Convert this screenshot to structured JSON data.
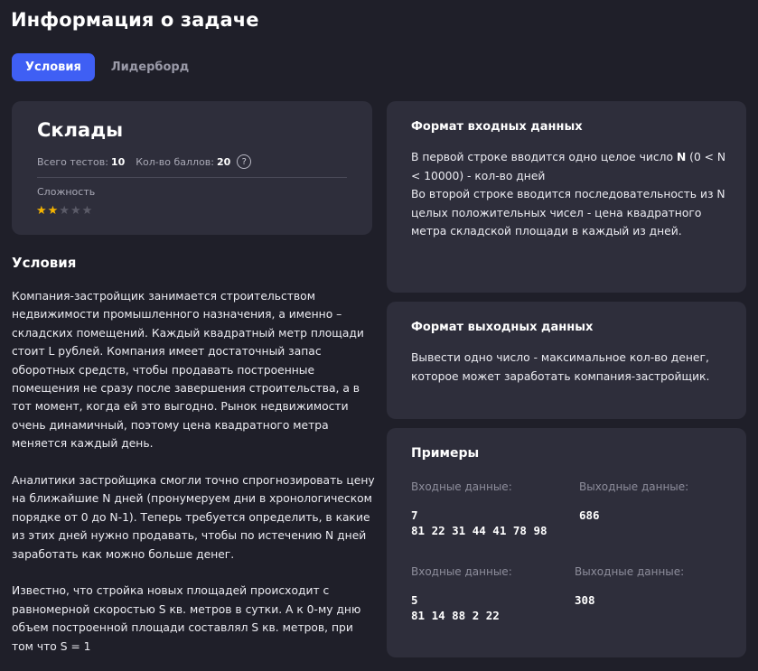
{
  "page_title": "Информация о задаче",
  "tabs": [
    {
      "label": "Условия",
      "active": true
    },
    {
      "label": "Лидерборд",
      "active": false
    }
  ],
  "task": {
    "name": "Склады",
    "total_tests_label": "Всего тестов:",
    "total_tests": "10",
    "points_label": "Кол-во баллов:",
    "points": "20",
    "help_icon": "?",
    "difficulty_label": "Сложность",
    "difficulty_rating": 2,
    "difficulty_max": 5
  },
  "conditions": {
    "heading": "Условия",
    "paragraphs": [
      "Компания-застройщик занимается строительством недвижимости промышленного назначения, а именно – складских помещений. Каждый квадратный метр площади стоит L рублей. Компания имеет достаточный запас оборотных средств, чтобы продавать построенные помещения не сразу после завершения строительства, а в тот момент, когда ей это выгодно. Рынок недвижимости очень динамичный, поэтому цена квадратного метра меняется каждый день.",
      "Аналитики застройщика смогли точно спрогнозировать цену на ближайшие N дней (пронумеруем дни в хронологическом порядке от 0 до N-1). Теперь требуется определить, в какие из этих дней нужно продавать, чтобы по истечению N дней заработать как можно больше денег.",
      "Известно, что стройка новых площадей происходит с равномерной скоростью S кв. метров в сутки. А к 0-му дню объем построенной площади составлял S кв. метров, при том что S = 1"
    ]
  },
  "input_format": {
    "title": "Формат входных данных",
    "text_part1": "В первой строке вводится одно целое число ",
    "text_bold": "N",
    "text_part2": " (0 < N < 10000) - кол-во дней",
    "text_line2": "Во второй строке вводится последовательность из N целых положительных чисел - цена квадратного метра складской площади в каждый из дней."
  },
  "output_format": {
    "title": "Формат выходных данных",
    "text": "Вывести одно число - максимальное кол-во денег, которое может заработать компания-застройщик."
  },
  "examples": {
    "title": "Примеры",
    "items": [
      {
        "input_label": "Входные данные:",
        "output_label": "Выходные данные:",
        "input_line1": "7",
        "input_line2": "81 22 31 44 41 78 98",
        "output": "686"
      },
      {
        "input_label": "Входные данные:",
        "output_label": "Выходные данные:",
        "input_line1": "5",
        "input_line2": "81 14 88 2 22",
        "output": "308"
      }
    ]
  },
  "colors": {
    "background": "#1f1f29",
    "card": "#2e2e3b",
    "accent": "#3f5ff4",
    "star_active": "#f5b400",
    "star_inactive": "#5b5b68"
  }
}
